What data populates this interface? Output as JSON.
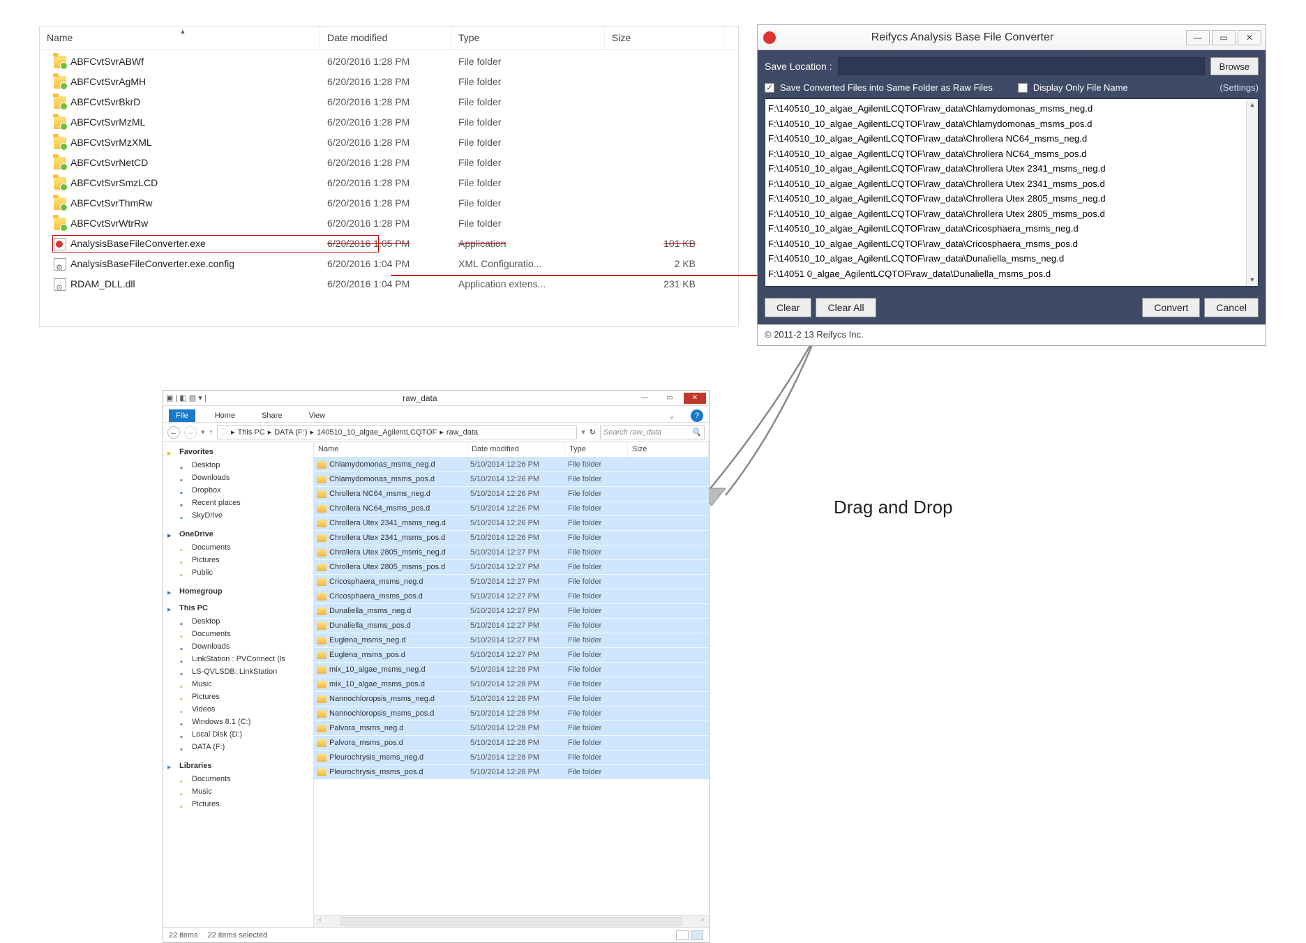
{
  "panel1": {
    "columns": {
      "name": "Name",
      "date": "Date modified",
      "type": "Type",
      "size": "Size"
    },
    "rows": [
      {
        "icon": "folder",
        "name": "ABFCvtSvrABWf",
        "date": "6/20/2016 1:28 PM",
        "type": "File folder",
        "size": ""
      },
      {
        "icon": "folder",
        "name": "ABFCvtSvrAgMH",
        "date": "6/20/2016 1:28 PM",
        "type": "File folder",
        "size": ""
      },
      {
        "icon": "folder",
        "name": "ABFCvtSvrBkrD",
        "date": "6/20/2016 1:28 PM",
        "type": "File folder",
        "size": ""
      },
      {
        "icon": "folder",
        "name": "ABFCvtSvrMzML",
        "date": "6/20/2016 1:28 PM",
        "type": "File folder",
        "size": ""
      },
      {
        "icon": "folder",
        "name": "ABFCvtSvrMzXML",
        "date": "6/20/2016 1:28 PM",
        "type": "File folder",
        "size": ""
      },
      {
        "icon": "folder",
        "name": "ABFCvtSvrNetCD",
        "date": "6/20/2016 1:28 PM",
        "type": "File folder",
        "size": ""
      },
      {
        "icon": "folder",
        "name": "ABFCvtSvrSmzLCD",
        "date": "6/20/2016 1:28 PM",
        "type": "File folder",
        "size": ""
      },
      {
        "icon": "folder",
        "name": "ABFCvtSvrThmRw",
        "date": "6/20/2016 1:28 PM",
        "type": "File folder",
        "size": ""
      },
      {
        "icon": "folder",
        "name": "ABFCvtSvrWtrRw",
        "date": "6/20/2016 1:28 PM",
        "type": "File folder",
        "size": ""
      },
      {
        "icon": "app",
        "name": "AnalysisBaseFileConverter.exe",
        "date": "6/20/2016 1:05 PM",
        "type": "Application",
        "size": "101 KB",
        "hl": true
      },
      {
        "icon": "cfg",
        "name": "AnalysisBaseFileConverter.exe.config",
        "date": "6/20/2016 1:04 PM",
        "type": "XML Configuratio...",
        "size": "2 KB"
      },
      {
        "icon": "dll",
        "name": "RDAM_DLL.dll",
        "date": "6/20/2016 1:04 PM",
        "type": "Application extens...",
        "size": "231 KB"
      }
    ]
  },
  "dialog": {
    "title": "Reifycs Analysis Base File Converter",
    "saveLabel": "Save Location :",
    "browse": "Browse",
    "opt1": "Save Converted Files into Same Folder as Raw Files",
    "opt2": "Display Only File Name",
    "settings": "(Settings)",
    "files": [
      "F:\\140510_10_algae_AgilentLCQTOF\\raw_data\\Chlamydomonas_msms_neg.d",
      "F:\\140510_10_algae_AgilentLCQTOF\\raw_data\\Chlamydomonas_msms_pos.d",
      "F:\\140510_10_algae_AgilentLCQTOF\\raw_data\\Chrollera NC64_msms_neg.d",
      "F:\\140510_10_algae_AgilentLCQTOF\\raw_data\\Chrollera NC64_msms_pos.d",
      "F:\\140510_10_algae_AgilentLCQTOF\\raw_data\\Chrollera Utex 2341_msms_neg.d",
      "F:\\140510_10_algae_AgilentLCQTOF\\raw_data\\Chrollera Utex 2341_msms_pos.d",
      "F:\\140510_10_algae_AgilentLCQTOF\\raw_data\\Chrollera Utex 2805_msms_neg.d",
      "F:\\140510_10_algae_AgilentLCQTOF\\raw_data\\Chrollera Utex 2805_msms_pos.d",
      "F:\\140510_10_algae_AgilentLCQTOF\\raw_data\\Cricosphaera_msms_neg.d",
      "F:\\140510_10_algae_AgilentLCQTOF\\raw_data\\Cricosphaera_msms_pos.d",
      "F:\\140510_10_algae_AgilentLCQTOF\\raw_data\\Dunaliella_msms_neg.d",
      "F:\\14051   0_algae_AgilentLCQTOF\\raw_data\\Dunaliella_msms_pos.d"
    ],
    "buttons": {
      "clear": "Clear",
      "clearAll": "Clear All",
      "convert": "Convert",
      "cancel": "Cancel"
    },
    "footer": "© 2011-2  13 Reifycs Inc."
  },
  "explorer": {
    "windowTitle": "raw_data",
    "ribbon": {
      "file": "File",
      "home": "Home",
      "share": "Share",
      "view": "View"
    },
    "breadcrumb": [
      "This PC",
      "DATA (F:)",
      "140510_10_algae_AgilentLCQTOF",
      "raw_data"
    ],
    "searchPlaceholder": "Search raw_data",
    "sidebar": [
      {
        "header": "Favorites",
        "icon": "mi-star",
        "items": [
          {
            "icon": "mi-desk",
            "label": "Desktop"
          },
          {
            "icon": "mi-dl",
            "label": "Downloads"
          },
          {
            "icon": "mi-box",
            "label": "Dropbox"
          },
          {
            "icon": "mi-rec",
            "label": "Recent places"
          },
          {
            "icon": "mi-sky",
            "label": "SkyDrive"
          }
        ]
      },
      {
        "header": "OneDrive",
        "icon": "mi-one",
        "items": [
          {
            "icon": "mi-fld",
            "label": "Documents"
          },
          {
            "icon": "mi-fld",
            "label": "Pictures"
          },
          {
            "icon": "mi-fld",
            "label": "Public"
          }
        ]
      },
      {
        "header": "Homegroup",
        "icon": "mi-hg",
        "items": []
      },
      {
        "header": "This PC",
        "icon": "mi-pc",
        "items": [
          {
            "icon": "mi-desk",
            "label": "Desktop"
          },
          {
            "icon": "mi-fld",
            "label": "Documents"
          },
          {
            "icon": "mi-dl",
            "label": "Downloads"
          },
          {
            "icon": "mi-drv",
            "label": "LinkStation : PVConnect (ls"
          },
          {
            "icon": "mi-drv",
            "label": "LS-QVLSDB: LinkStation"
          },
          {
            "icon": "mi-fld",
            "label": "Music"
          },
          {
            "icon": "mi-fld",
            "label": "Pictures"
          },
          {
            "icon": "mi-fld",
            "label": "Videos"
          },
          {
            "icon": "mi-drv",
            "label": "Windows 8.1 (C:)"
          },
          {
            "icon": "mi-drv",
            "label": "Local Disk (D:)"
          },
          {
            "icon": "mi-drv",
            "label": "DATA (F:)"
          }
        ]
      },
      {
        "header": "Libraries",
        "icon": "mi-lib",
        "items": [
          {
            "icon": "mi-fld",
            "label": "Documents"
          },
          {
            "icon": "mi-fld",
            "label": "Music"
          },
          {
            "icon": "mi-fld",
            "label": "Pictures"
          }
        ]
      }
    ],
    "columns": {
      "name": "Name",
      "date": "Date modified",
      "type": "Type",
      "size": "Size"
    },
    "rows": [
      {
        "name": "Chlamydomonas_msms_neg.d",
        "date": "5/10/2014 12:26 PM",
        "type": "File folder"
      },
      {
        "name": "Chlamydomonas_msms_pos.d",
        "date": "5/10/2014 12:26 PM",
        "type": "File folder"
      },
      {
        "name": "Chrollera NC64_msms_neg.d",
        "date": "5/10/2014 12:26 PM",
        "type": "File folder"
      },
      {
        "name": "Chrollera NC64_msms_pos.d",
        "date": "5/10/2014 12:26 PM",
        "type": "File folder"
      },
      {
        "name": "Chrollera Utex 2341_msms_neg.d",
        "date": "5/10/2014 12:26 PM",
        "type": "File folder"
      },
      {
        "name": "Chrollera Utex 2341_msms_pos.d",
        "date": "5/10/2014 12:26 PM",
        "type": "File folder"
      },
      {
        "name": "Chrollera Utex 2805_msms_neg.d",
        "date": "5/10/2014 12:27 PM",
        "type": "File folder"
      },
      {
        "name": "Chrollera Utex 2805_msms_pos.d",
        "date": "5/10/2014 12:27 PM",
        "type": "File folder"
      },
      {
        "name": "Cricosphaera_msms_neg.d",
        "date": "5/10/2014 12:27 PM",
        "type": "File folder"
      },
      {
        "name": "Cricosphaera_msms_pos.d",
        "date": "5/10/2014 12:27 PM",
        "type": "File folder"
      },
      {
        "name": "Dunaliella_msms_neg.d",
        "date": "5/10/2014 12:27 PM",
        "type": "File folder"
      },
      {
        "name": "Dunaliella_msms_pos.d",
        "date": "5/10/2014 12:27 PM",
        "type": "File folder"
      },
      {
        "name": "Euglena_msms_neg.d",
        "date": "5/10/2014 12:27 PM",
        "type": "File folder"
      },
      {
        "name": "Euglena_msms_pos.d",
        "date": "5/10/2014 12:27 PM",
        "type": "File folder"
      },
      {
        "name": "mix_10_algae_msms_neg.d",
        "date": "5/10/2014 12:28 PM",
        "type": "File folder"
      },
      {
        "name": "mix_10_algae_msms_pos.d",
        "date": "5/10/2014 12:28 PM",
        "type": "File folder"
      },
      {
        "name": "Nannochloropsis_msms_neg.d",
        "date": "5/10/2014 12:28 PM",
        "type": "File folder"
      },
      {
        "name": "Nannochloropsis_msms_pos.d",
        "date": "5/10/2014 12:28 PM",
        "type": "File folder"
      },
      {
        "name": "Palvora_msms_neg.d",
        "date": "5/10/2014 12:28 PM",
        "type": "File folder"
      },
      {
        "name": "Palvora_msms_pos.d",
        "date": "5/10/2014 12:28 PM",
        "type": "File folder"
      },
      {
        "name": "Pleurochrysis_msms_neg.d",
        "date": "5/10/2014 12:28 PM",
        "type": "File folder"
      },
      {
        "name": "Pleurochrysis_msms_pos.d",
        "date": "5/10/2014 12:28 PM",
        "type": "File folder"
      }
    ],
    "status": {
      "count": "22 items",
      "selected": "22 items selected"
    }
  },
  "annotation": {
    "drag": "Drag and Drop"
  }
}
